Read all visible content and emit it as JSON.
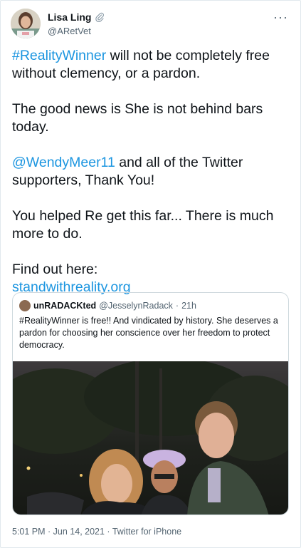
{
  "tweet": {
    "author": {
      "display_name": "Lisa Ling",
      "handle": "@ARetVet",
      "badge_icon": "paperclip-icon"
    },
    "more_icon": "more-options-icon",
    "paragraphs": [
      [
        {
          "text": "#RealityWinner",
          "link": true
        },
        {
          "text": " will not be completely free without clemency, or a pardon.",
          "link": false
        }
      ],
      [
        {
          "text": "The good news is She is not behind bars today.",
          "link": false
        }
      ],
      [
        {
          "text": "@WendyMeer11",
          "link": true
        },
        {
          "text": " and all of the Twitter supporters, Thank You!",
          "link": false
        }
      ],
      [
        {
          "text": "You helped Re get this far... There is much more to do.",
          "link": false
        }
      ],
      [
        {
          "text": "Find out here:",
          "link": false,
          "break_after": true
        },
        {
          "text": "standwithreality.org",
          "link": true
        }
      ]
    ],
    "quoted": {
      "display_name": "unRADACKted",
      "handle": "@JesselynRadack",
      "separator": "·",
      "time": "21h",
      "text": "#RealityWinner is free!! And vindicated by history. She deserves a pardon for choosing her conscience over her freedom to protect democracy."
    },
    "meta": "5:01 PM · Jun 14, 2021 · Twitter for iPhone",
    "colors": {
      "link": "#1b95e0",
      "secondary": "#536471",
      "border": "#cfd9de"
    }
  }
}
